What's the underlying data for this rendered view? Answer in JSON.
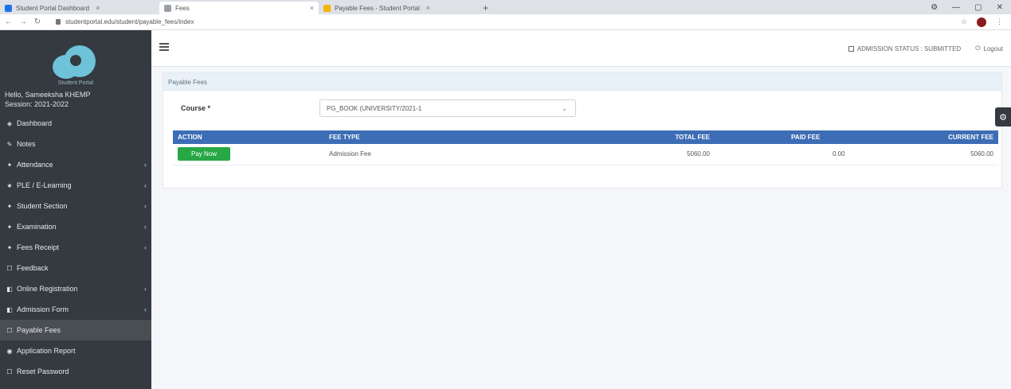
{
  "browser": {
    "tabs": [
      {
        "label": "Student Portal Dashboard",
        "color": "#1a73e8",
        "active": false
      },
      {
        "label": "Fees",
        "color": "#9aa0a6",
        "active": true
      },
      {
        "label": "Payable Fees - Student Portal",
        "color": "#f4b400",
        "active": false
      }
    ],
    "url": "studentportal.edu/student/payable_fees/index"
  },
  "sidebar": {
    "logo_text": "Student Portal",
    "user_name": "Hello, Sameeksha KHEMP",
    "session": "Session: 2021-2022",
    "items": [
      {
        "label": "Dashboard",
        "icon": "◈",
        "arrow": false,
        "active": false
      },
      {
        "label": "Notes",
        "icon": "✎",
        "arrow": false,
        "active": false
      },
      {
        "label": "Attendance",
        "icon": "✦",
        "arrow": true,
        "active": false
      },
      {
        "label": "PLE / E-Learning",
        "icon": "★",
        "arrow": true,
        "active": false
      },
      {
        "label": "Student Section",
        "icon": "✦",
        "arrow": true,
        "active": false
      },
      {
        "label": "Examination",
        "icon": "✦",
        "arrow": true,
        "active": false
      },
      {
        "label": "Fees Receipt",
        "icon": "✦",
        "arrow": true,
        "active": false
      },
      {
        "label": "Feedback",
        "icon": "☐",
        "arrow": false,
        "active": false
      },
      {
        "label": "Online Registration",
        "icon": "◧",
        "arrow": true,
        "active": false
      },
      {
        "label": "Admission Form",
        "icon": "◧",
        "arrow": true,
        "active": false
      },
      {
        "label": "Payable Fees",
        "icon": "☐",
        "arrow": false,
        "active": true
      },
      {
        "label": "Application Report",
        "icon": "◉",
        "arrow": false,
        "active": false
      },
      {
        "label": "Reset Password",
        "icon": "☐",
        "arrow": false,
        "active": false
      }
    ]
  },
  "topnav": {
    "info": "ADMISSION STATUS : SUBMITTED",
    "logout": "Logout"
  },
  "main": {
    "card_title": "Payable Fees",
    "course_label": "Course *",
    "course_value": "PG_BOOK (UNIVERSITY/2021-1",
    "table": {
      "headers": [
        "ACTION",
        "FEE TYPE",
        "TOTAL FEE",
        "PAID FEE",
        "CURRENT FEE"
      ],
      "rows": [
        {
          "action_label": "Pay Now",
          "fee_type": "Admission Fee",
          "total_fee": "5060.00",
          "paid_fee": "0.00",
          "current_fee": "5060.00"
        }
      ]
    }
  },
  "colors": {
    "sidebar_bg": "#343a40",
    "table_header": "#3d6db5",
    "pay_button": "#28a745"
  }
}
